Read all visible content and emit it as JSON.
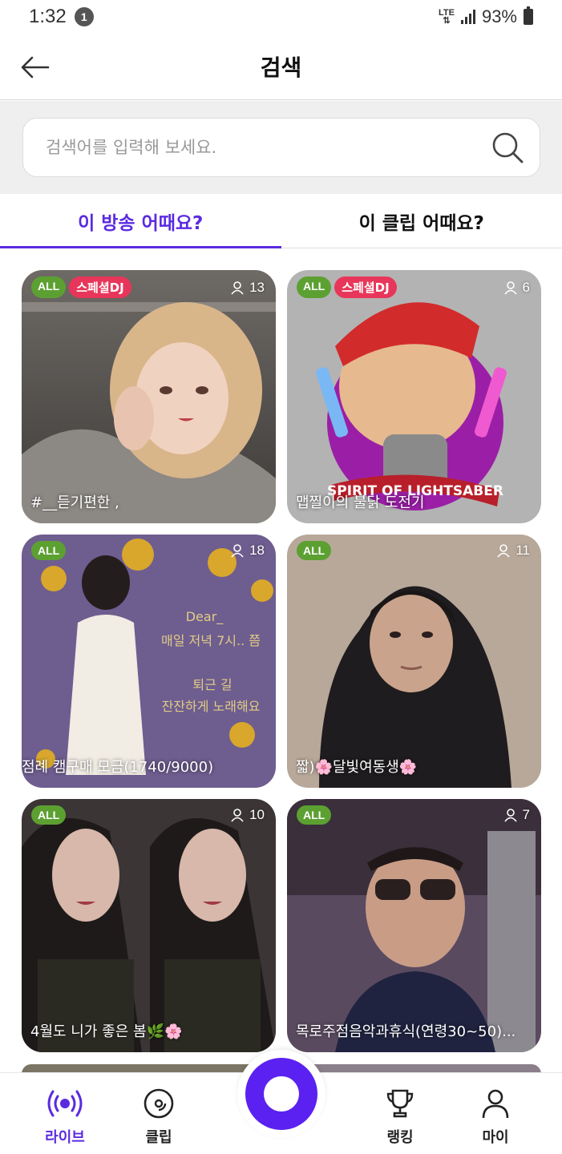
{
  "status": {
    "time": "1:32",
    "notification_count": "1",
    "network": "LTE",
    "battery": "93%"
  },
  "header": {
    "title": "검색"
  },
  "search": {
    "placeholder": "검색어를 입력해 보세요."
  },
  "tabs": [
    {
      "label": "이 방송 어때요?",
      "active": true
    },
    {
      "label": "이 클립 어때요?",
      "active": false
    }
  ],
  "cards": [
    {
      "title": "#__듣기편한 ,",
      "viewers": "13",
      "age": "ALL",
      "special": "스페셜DJ"
    },
    {
      "title": "맵찔이의 불닭 도전기",
      "viewers": "6",
      "age": "ALL",
      "special": "스페셜DJ",
      "art_text": "SPIRIT OF LIGHTSABER"
    },
    {
      "title": "점례 캠구매 모금(1740/9000)",
      "viewers": "18",
      "age": "ALL",
      "art_lines": [
        "Dear_",
        "매일 저녁 7시.. 쯤",
        "퇴근 길",
        "잔잔하게 노래해요"
      ]
    },
    {
      "title": "짧)🌸달빛여동생🌸",
      "viewers": "11",
      "age": "ALL"
    },
    {
      "title": "4월도 니가 좋은 봄🌿🌸",
      "viewers": "10",
      "age": "ALL"
    },
    {
      "title": "목로주점음악과휴식(연령30~50)...",
      "viewers": "7",
      "age": "ALL"
    }
  ],
  "nav": [
    {
      "label": "라이브",
      "icon": "live-icon",
      "active": true
    },
    {
      "label": "클립",
      "icon": "clip-icon",
      "active": false
    },
    {
      "label": "랭킹",
      "icon": "trophy-icon",
      "active": false
    },
    {
      "label": "마이",
      "icon": "person-icon",
      "active": false
    }
  ],
  "colors": {
    "accent": "#5b2be0",
    "fab": "#5a21f0",
    "badge_all": "#5ca032",
    "badge_special": "#e8365a"
  }
}
